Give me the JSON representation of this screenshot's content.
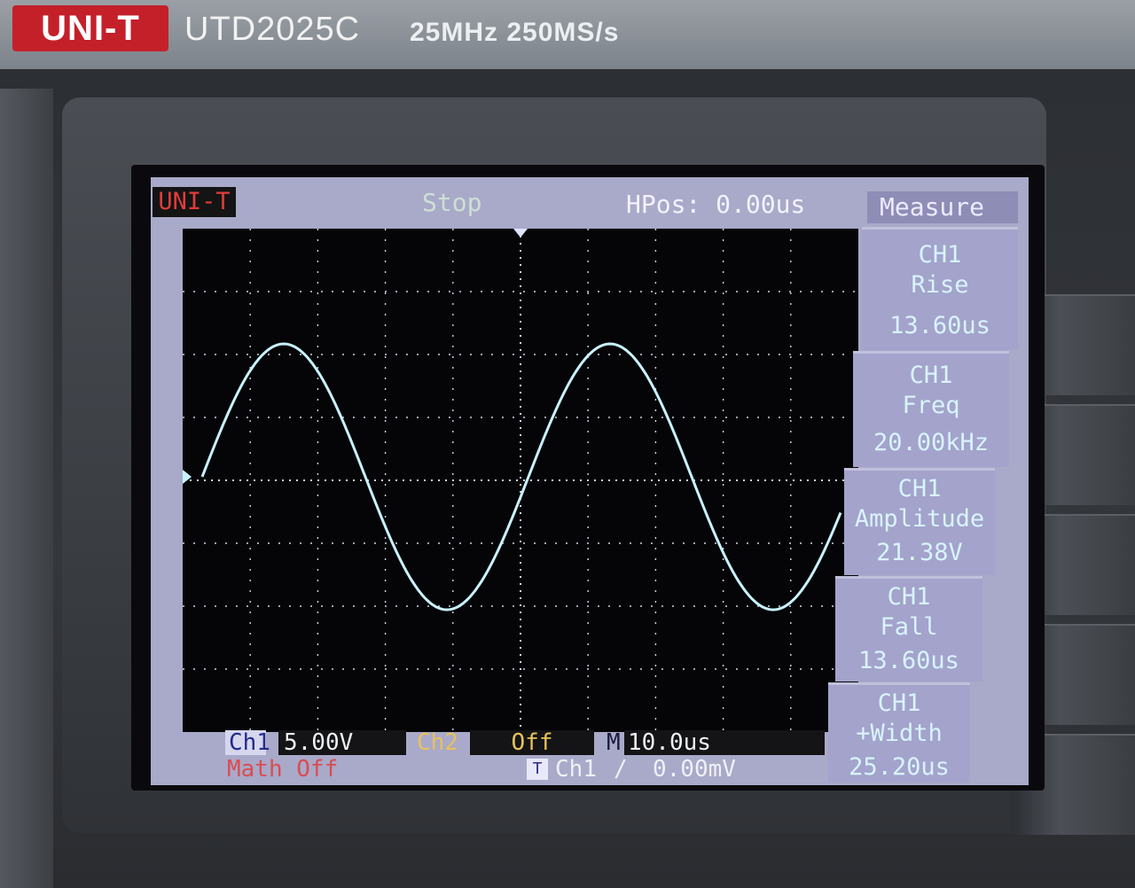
{
  "device": {
    "brand": "UNI-T",
    "model": "UTD2025C",
    "spec": "25MHz 250MS/s"
  },
  "screen": {
    "logo": "UNI-T",
    "status": "Stop",
    "hpos": "HPos: 0.00us",
    "menu_title": "Measure"
  },
  "measurements": [
    {
      "channel": "CH1",
      "name": "Rise",
      "value": "13.60us"
    },
    {
      "channel": "CH1",
      "name": "Freq",
      "value": "20.00kHz"
    },
    {
      "channel": "CH1",
      "name": "Amplitude",
      "value": "21.38V"
    },
    {
      "channel": "CH1",
      "name": "Fall",
      "value": "13.60us"
    },
    {
      "channel": "CH1",
      "name": "+Width",
      "value": "25.20us"
    }
  ],
  "status_bar": {
    "ch1_label": "Ch1",
    "ch1_scale": "5.00V",
    "ch2_label": "Ch2",
    "ch2_state": "Off",
    "time_label": "M",
    "time_scale": "10.0us",
    "math": "Math Off",
    "trigger_icon": "T",
    "trigger_source": "Ch1",
    "trigger_slope": "/",
    "trigger_level": "0.00mV"
  },
  "waveform": {
    "type": "sine",
    "color": "#c8f2ff",
    "grid_color": "#cfd3ea"
  }
}
